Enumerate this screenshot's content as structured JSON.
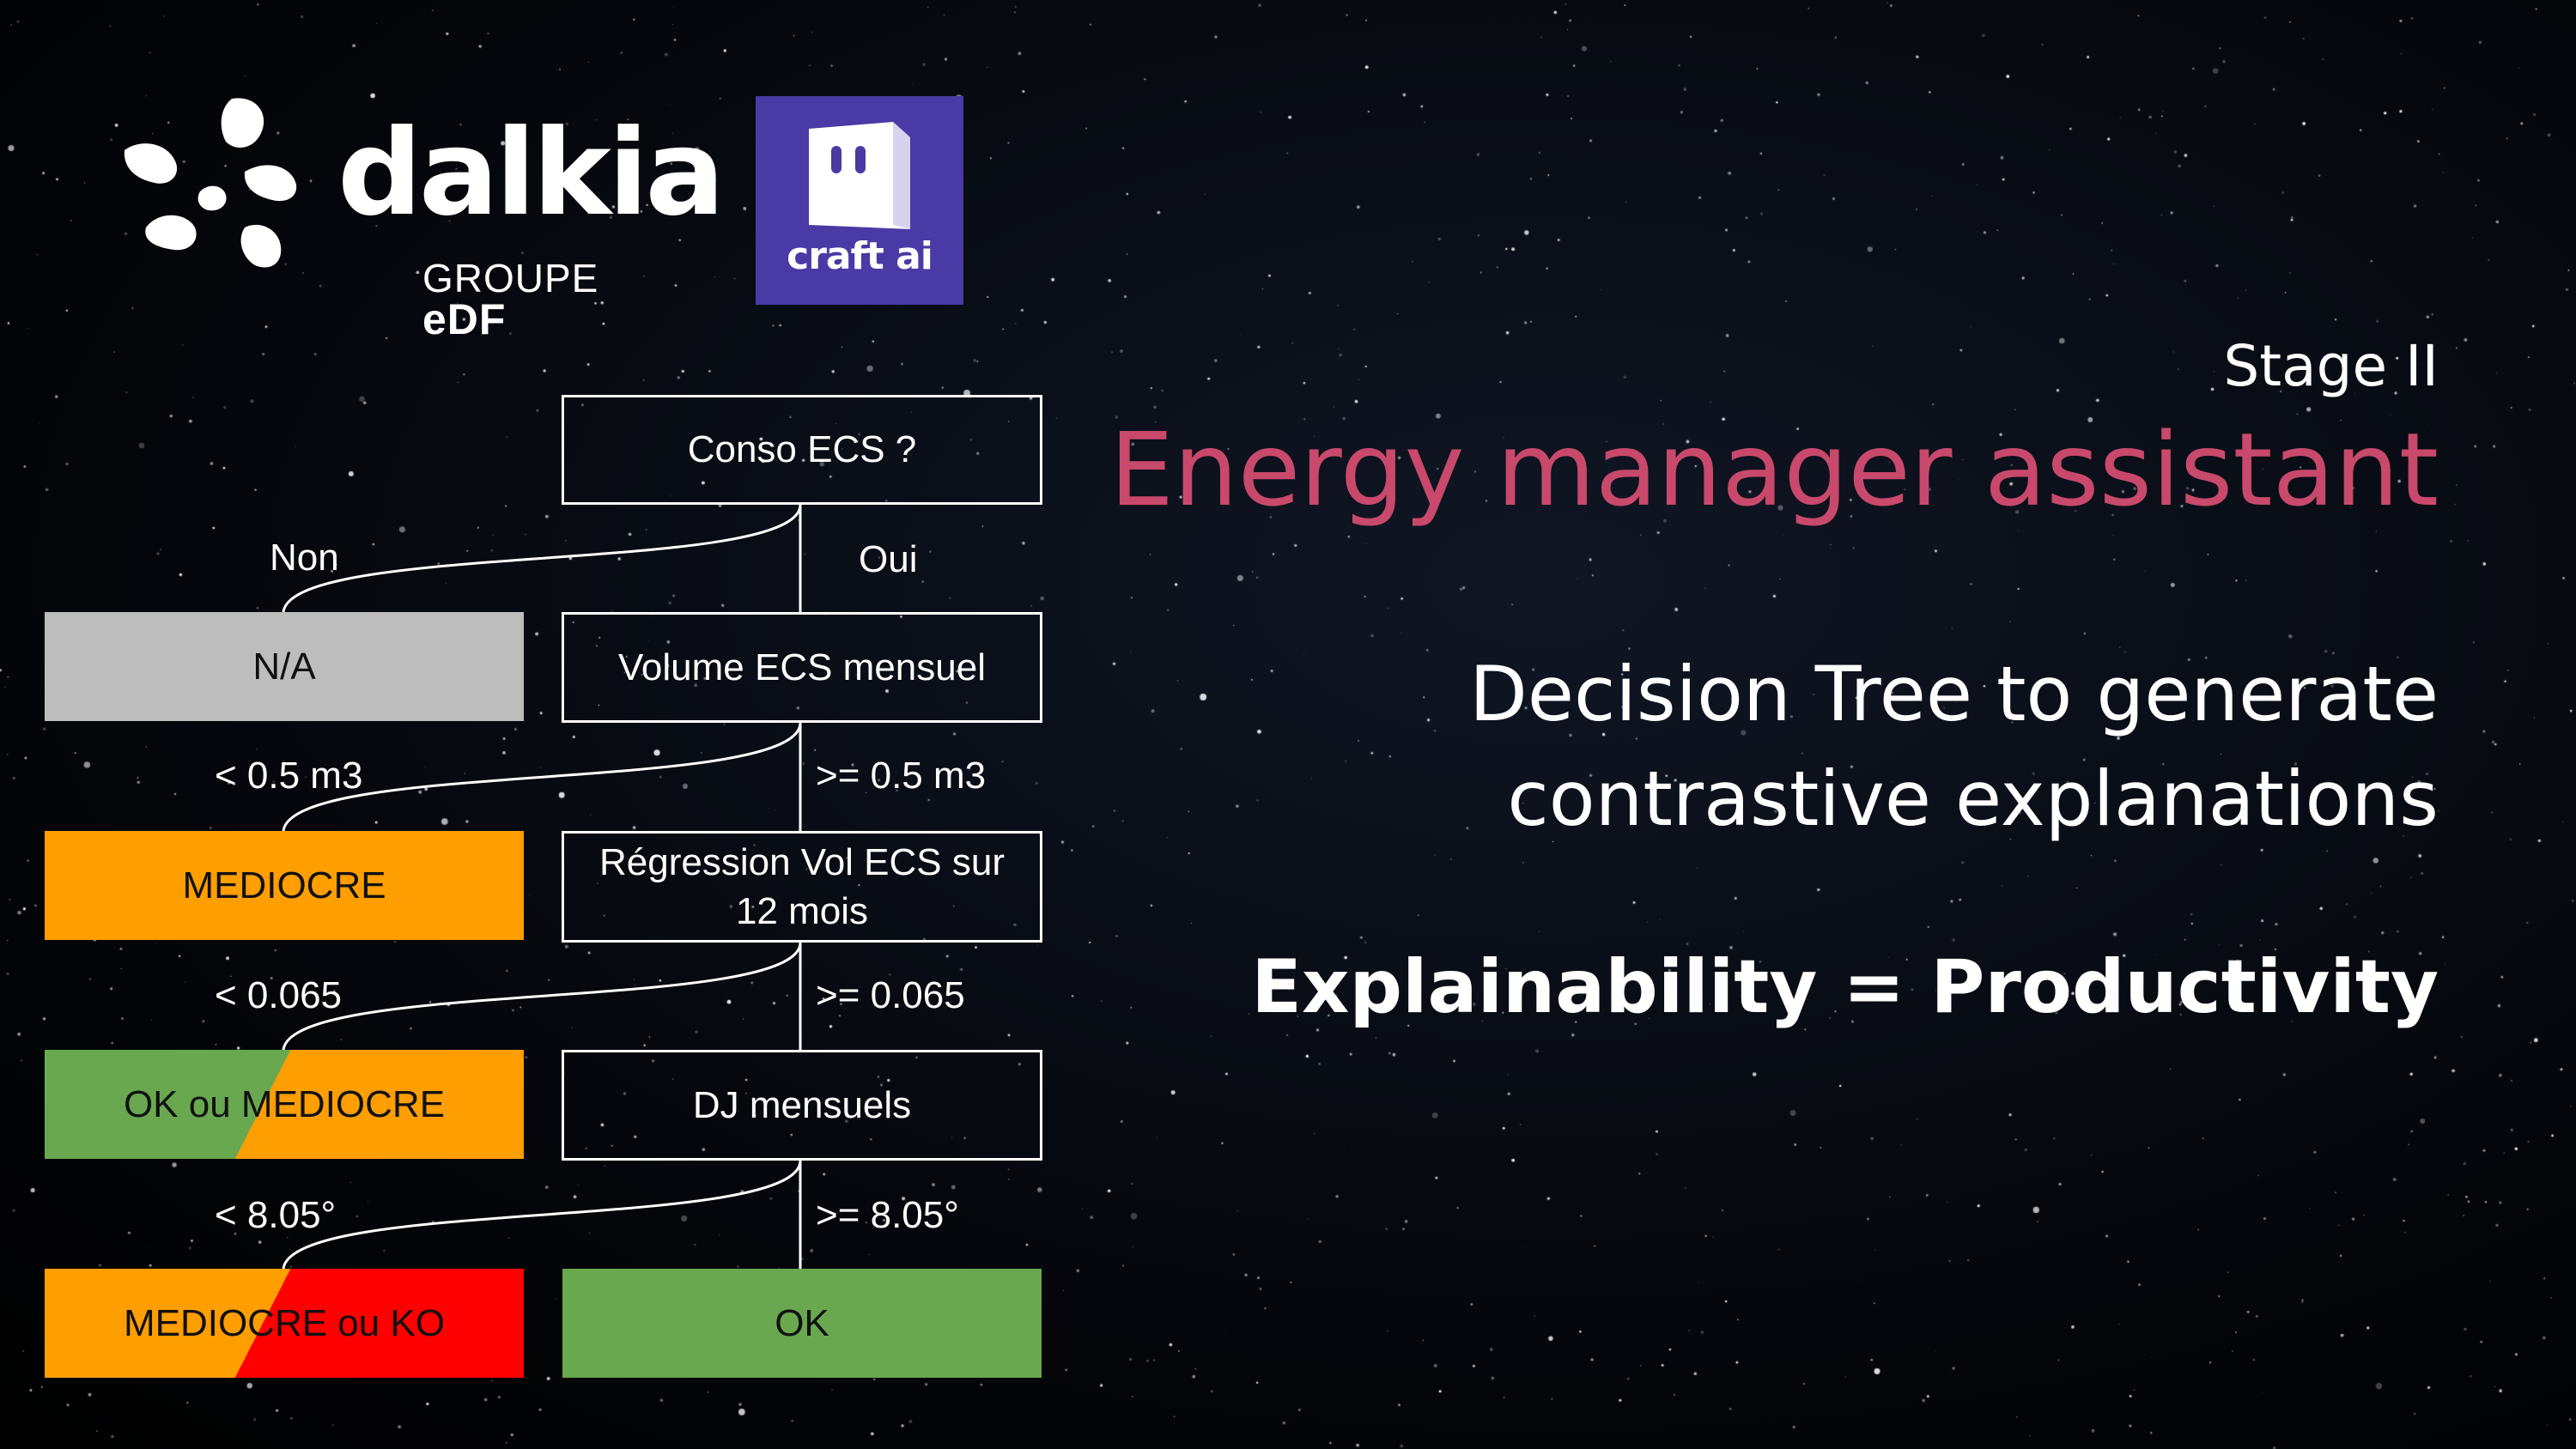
{
  "logos": {
    "dalkia": {
      "word": "dalkia",
      "group_prefix": "GROUPE",
      "group_brand": "eDF"
    },
    "craft_ai": {
      "word": "craft ai",
      "background": "#4a3aa5"
    }
  },
  "header": {
    "stage": "Stage II",
    "title": "Energy manager assistant",
    "title_color": "#c8496b",
    "subtitle_line1": "Decision Tree to generate",
    "subtitle_line2": "contrastive explanations",
    "tagline": "Explainability = Productivity"
  },
  "tree": {
    "decisions": [
      {
        "label": "Conso ECS ?"
      },
      {
        "label": "Volume ECS mensuel"
      },
      {
        "label_line1": "Régression Vol ECS sur",
        "label_line2": "12 mois"
      },
      {
        "label": "DJ mensuels"
      }
    ],
    "edges": [
      {
        "left": "Non",
        "right": "Oui"
      },
      {
        "left": "< 0.5 m3",
        "right": ">= 0.5 m3"
      },
      {
        "left": "< 0.065",
        "right": ">= 0.065"
      },
      {
        "left": "< 8.05°",
        "right": ">= 8.05°"
      }
    ],
    "leaves": [
      {
        "label": "N/A",
        "colors": [
          "#bdbdbd"
        ]
      },
      {
        "label": "MEDIOCRE",
        "colors": [
          "#ff9e00"
        ]
      },
      {
        "label": "OK ou MEDIOCRE",
        "colors": [
          "#6aa84f",
          "#ff9e00"
        ]
      },
      {
        "label": "MEDIOCRE ou KO",
        "colors": [
          "#ff9e00",
          "#ff0000"
        ]
      },
      {
        "label": "OK",
        "colors": [
          "#6aa84f"
        ]
      }
    ]
  }
}
